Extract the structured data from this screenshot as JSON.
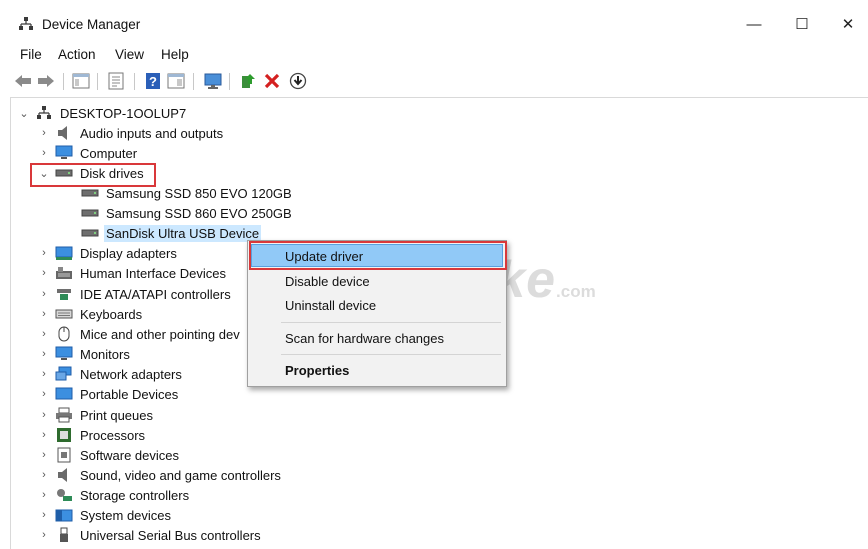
{
  "window": {
    "title": "Device Manager",
    "minimize": "—",
    "maximize": "☐",
    "close": "✕"
  },
  "menu": [
    "File",
    "Action",
    "View",
    "Help"
  ],
  "toolbar_icons": [
    "back-arrow-icon",
    "forward-arrow-icon",
    "show-hide-tree-icon",
    "properties-icon",
    "help-icon",
    "view-icon",
    "monitor-icon",
    "update-driver-icon",
    "uninstall-x-icon",
    "download-icon"
  ],
  "tree": {
    "root": "DESKTOP-1OOLUP7",
    "categories": [
      {
        "label": "Audio inputs and outputs",
        "icon": "speaker-icon",
        "expanded": false
      },
      {
        "label": "Computer",
        "icon": "monitor-icon",
        "expanded": false
      },
      {
        "label": "Disk drives",
        "icon": "disk-drive-icon",
        "expanded": true
      },
      {
        "label": "Display adapters",
        "icon": "display-adapter-icon",
        "expanded": false
      },
      {
        "label": "Human Interface Devices",
        "icon": "hid-icon",
        "expanded": false
      },
      {
        "label": "IDE ATA/ATAPI controllers",
        "icon": "ide-controller-icon",
        "expanded": false
      },
      {
        "label": "Keyboards",
        "icon": "keyboard-icon",
        "expanded": false
      },
      {
        "label": "Mice and other pointing dev",
        "icon": "mouse-icon",
        "expanded": false
      },
      {
        "label": "Monitors",
        "icon": "monitor-icon",
        "expanded": false
      },
      {
        "label": "Network adapters",
        "icon": "network-icon",
        "expanded": false
      },
      {
        "label": "Portable Devices",
        "icon": "portable-device-icon",
        "expanded": false
      },
      {
        "label": "Print queues",
        "icon": "printer-icon",
        "expanded": false
      },
      {
        "label": "Processors",
        "icon": "processor-icon",
        "expanded": false
      },
      {
        "label": "Software devices",
        "icon": "software-device-icon",
        "expanded": false
      },
      {
        "label": "Sound, video and game controllers",
        "icon": "speaker-icon",
        "expanded": false
      },
      {
        "label": "Storage controllers",
        "icon": "storage-controller-icon",
        "expanded": false
      },
      {
        "label": "System devices",
        "icon": "system-devices-icon",
        "expanded": false
      },
      {
        "label": "Universal Serial Bus controllers",
        "icon": "usb-icon",
        "expanded": false
      }
    ],
    "disk_drives": [
      {
        "label": "Samsung SSD 850 EVO 120GB"
      },
      {
        "label": "Samsung SSD 860 EVO 250GB"
      },
      {
        "label": "SanDisk Ultra USB Device",
        "selected": true
      }
    ]
  },
  "context_menu": {
    "items": [
      {
        "label": "Update driver",
        "highlighted": true
      },
      {
        "label": "Disable device"
      },
      {
        "label": "Uninstall device"
      },
      {
        "label": "Scan for hardware changes"
      },
      {
        "label": "Properties",
        "bold": true
      }
    ]
  },
  "watermark": {
    "text": "TipsMake",
    "suffix": ".com"
  },
  "colors": {
    "selection": "#cce8ff",
    "hover": "#91c9f7",
    "annotation": "#d9383a"
  }
}
